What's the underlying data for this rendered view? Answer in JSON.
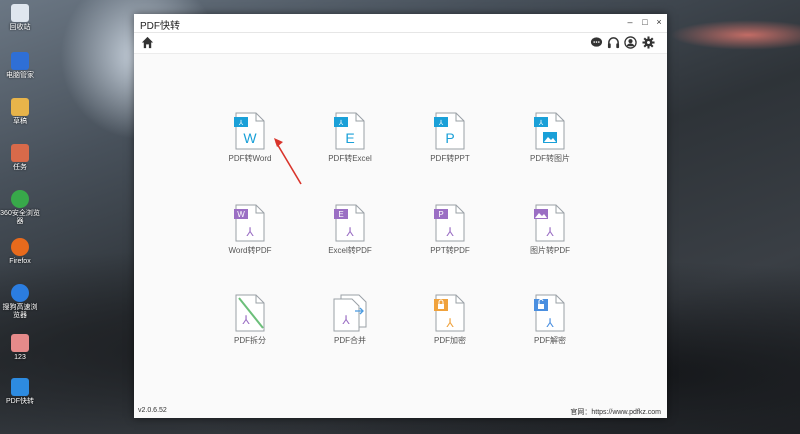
{
  "desktop": {
    "icons": [
      {
        "label": "回收站",
        "icon": "recycle-bin-icon",
        "color": "#dfe6ee"
      },
      {
        "label": "电脑管家",
        "icon": "pc-manager-icon",
        "color": "#2f6fd6"
      },
      {
        "label": "草稿",
        "icon": "draft-icon",
        "color": "#e8b44a"
      },
      {
        "label": "任务",
        "icon": "task-icon",
        "color": "#d86a4a"
      },
      {
        "label": "360安全浏览器",
        "icon": "browser-360-icon",
        "color": "#38a94a"
      },
      {
        "label": "Firefox",
        "icon": "firefox-icon",
        "color": "#e86a1c"
      },
      {
        "label": "搜狗高速浏览器",
        "icon": "sogou-browser-icon",
        "color": "#2b7de0"
      },
      {
        "label": "123",
        "icon": "file-icon",
        "color": "#e58a8a"
      },
      {
        "label": "PDF快转",
        "icon": "pdf-convert-app-icon",
        "color": "#2d8be0"
      }
    ]
  },
  "window": {
    "title": "PDF快转",
    "controls": {
      "minimize": "–",
      "maximize": "□",
      "close": "×"
    },
    "version": "v2.0.6.52",
    "website": "官网：https://www.pdfkz.com"
  },
  "tools": [
    {
      "label": "PDF转Word",
      "letter": "W",
      "color": "#1aa0d8",
      "kind": "pdf-to"
    },
    {
      "label": "PDF转Excel",
      "letter": "E",
      "color": "#1aa0d8",
      "kind": "pdf-to"
    },
    {
      "label": "PDF转PPT",
      "letter": "P",
      "color": "#1aa0d8",
      "kind": "pdf-to"
    },
    {
      "label": "PDF转图片",
      "letter": "",
      "color": "#1aa0d8",
      "kind": "pdf-to-img"
    },
    {
      "label": "Word转PDF",
      "letter": "W",
      "color": "#9b6fc4",
      "kind": "to-pdf"
    },
    {
      "label": "Excel转PDF",
      "letter": "E",
      "color": "#9b6fc4",
      "kind": "to-pdf"
    },
    {
      "label": "PPT转PDF",
      "letter": "P",
      "color": "#9b6fc4",
      "kind": "to-pdf"
    },
    {
      "label": "图片转PDF",
      "letter": "",
      "color": "#9b6fc4",
      "kind": "img-to-pdf"
    },
    {
      "label": "PDF拆分",
      "letter": "",
      "color": "#6cbf7a",
      "kind": "split"
    },
    {
      "label": "PDF合并",
      "letter": "",
      "color": "#4a9be0",
      "kind": "merge"
    },
    {
      "label": "PDF加密",
      "letter": "",
      "color": "#f0a23c",
      "kind": "encrypt"
    },
    {
      "label": "PDF解密",
      "letter": "",
      "color": "#4a8fe0",
      "kind": "decrypt"
    }
  ],
  "accent_arrow_color": "#d9342b"
}
